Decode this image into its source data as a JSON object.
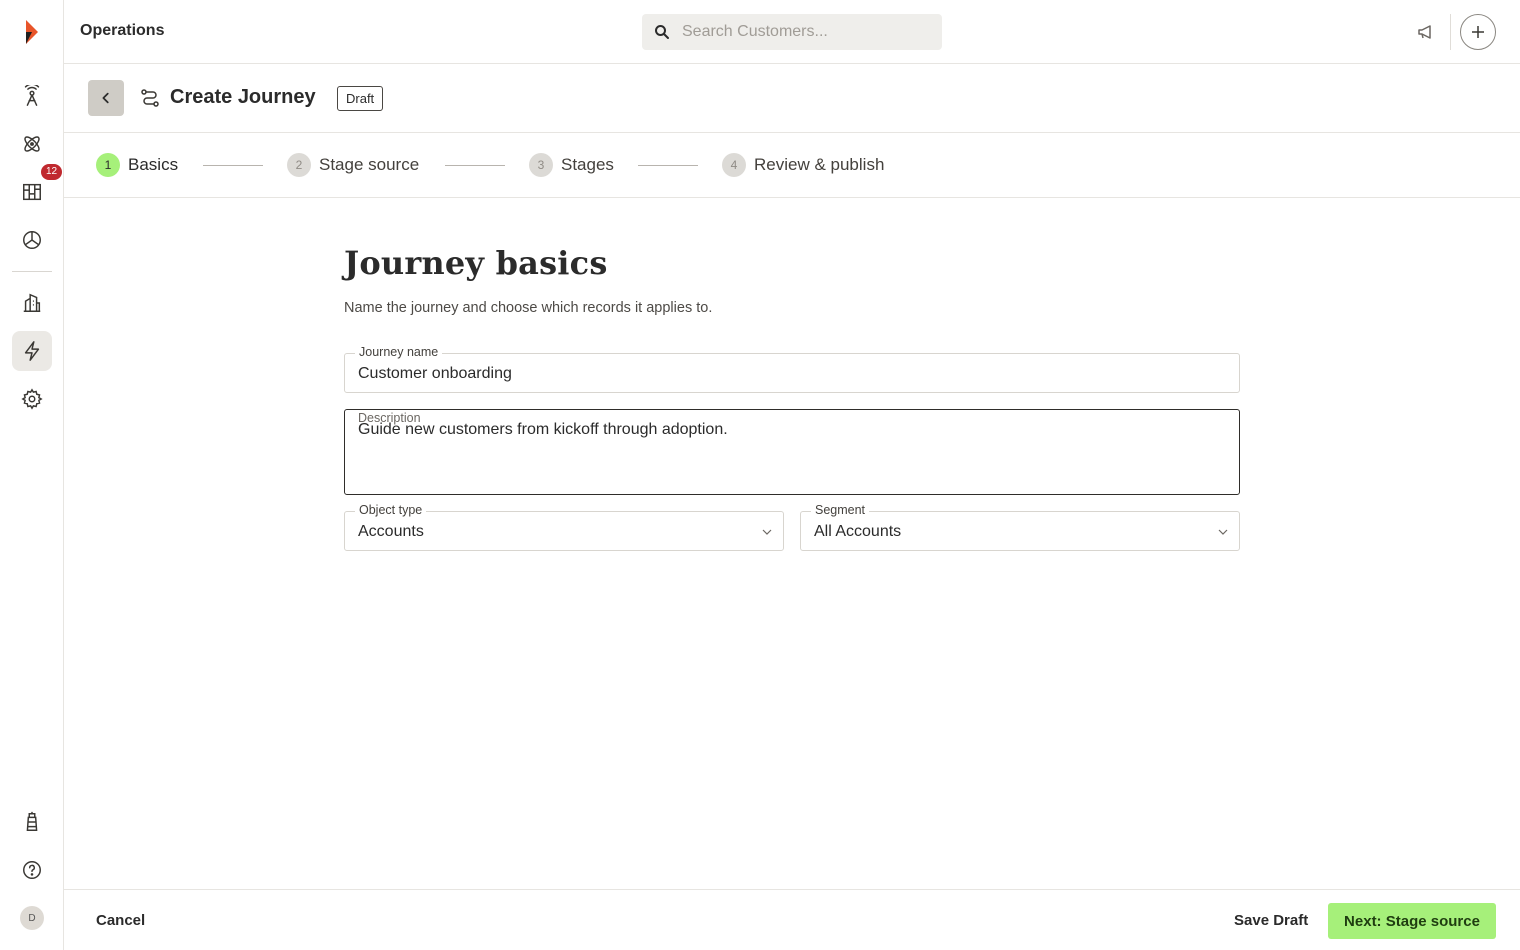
{
  "nav": {
    "badge_count": "12",
    "avatar_initial": "D",
    "items": [
      {
        "icon": "radar-icon"
      },
      {
        "icon": "atom-icon"
      },
      {
        "icon": "board-icon"
      },
      {
        "icon": "pie-chart-icon"
      },
      {
        "icon": "building-icon"
      },
      {
        "icon": "lightning-icon",
        "active": true
      },
      {
        "icon": "gear-icon"
      },
      {
        "icon": "lighthouse-icon"
      },
      {
        "icon": "help-icon"
      }
    ]
  },
  "topbar": {
    "workspace": "Operations",
    "search_placeholder": "Search Customers..."
  },
  "header": {
    "title": "Create Journey",
    "status": "Draft"
  },
  "stepper": {
    "steps": [
      {
        "num": "1",
        "label": "Basics",
        "active": true
      },
      {
        "num": "2",
        "label": "Stage source"
      },
      {
        "num": "3",
        "label": "Stages"
      },
      {
        "num": "4",
        "label": "Review & publish"
      }
    ]
  },
  "form": {
    "title": "Journey basics",
    "subtitle": "Name the journey and choose which records it applies to.",
    "name_label": "Journey name",
    "name_value": "Customer onboarding",
    "description_label": "Description",
    "description_value": "Guide new customers from kickoff through adoption.",
    "object_type_label": "Object type",
    "object_type_value": "Accounts",
    "segment_label": "Segment",
    "segment_value": "All Accounts"
  },
  "footer": {
    "cancel": "Cancel",
    "save_draft": "Save Draft",
    "next": "Next: Stage source"
  },
  "colors": {
    "accent": "#a6f07a",
    "badge": "#c0292f",
    "logo": "#e8552a"
  }
}
